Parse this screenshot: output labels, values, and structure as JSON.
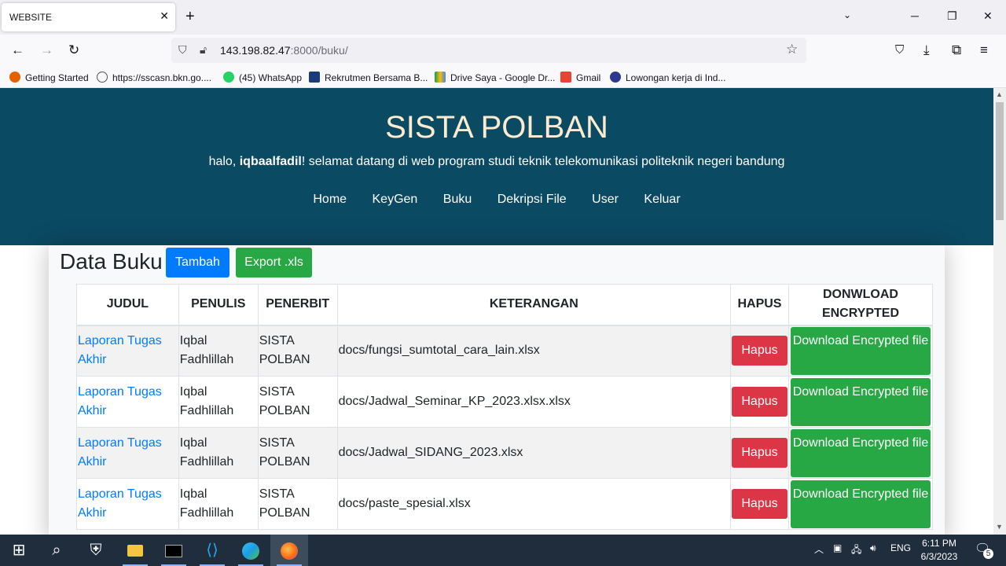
{
  "browser": {
    "tab_title": "WEBSITE",
    "url_host": "143.198.82.47",
    "url_path": ":8000/buku/",
    "bookmarks": [
      {
        "label": "Getting Started",
        "color": "#e66000"
      },
      {
        "label": "https://sscasn.bkn.go....",
        "color": "#555555"
      },
      {
        "label": "(45) WhatsApp",
        "color": "#25d366"
      },
      {
        "label": "Rekrutmen Bersama B...",
        "color": "#1a3b7a"
      },
      {
        "label": "Drive Saya - Google Dr...",
        "color": "#fbbc04"
      },
      {
        "label": "Gmail",
        "color": "#ea4335"
      },
      {
        "label": "Lowongan kerja di Ind...",
        "color": "#2b3990"
      }
    ]
  },
  "header": {
    "site_title": "SISTA POLBAN",
    "greeting_prefix": "halo, ",
    "username": "iqbaalfadil",
    "greeting_suffix": "! selamat datang di web program studi teknik telekomunikasi politeknik negeri bandung",
    "menu": [
      "Home",
      "KeyGen",
      "Buku",
      "Dekripsi File",
      "User",
      "Keluar"
    ]
  },
  "main": {
    "heading": "Data Buku",
    "add_button": "Tambah",
    "export_button": "Export .xls",
    "columns": [
      "JUDUL",
      "PENULIS",
      "PENERBIT",
      "KETERANGAN",
      "HAPUS",
      "DONWLOAD ENCRYPTED"
    ],
    "rows": [
      {
        "judul": "Laporan Tugas Akhir",
        "penulis": "Iqbal Fadhlillah",
        "penerbit": "SISTA POLBAN",
        "keterangan": "docs/fungsi_sumtotal_cara_lain.xlsx",
        "hapus": "Hapus",
        "download": "Download Encrypted file"
      },
      {
        "judul": "Laporan Tugas Akhir",
        "penulis": "Iqbal Fadhlillah",
        "penerbit": "SISTA POLBAN",
        "keterangan": "docs/Jadwal_Seminar_KP_2023.xlsx.xlsx",
        "hapus": "Hapus",
        "download": "Download Encrypted file"
      },
      {
        "judul": "Laporan Tugas Akhir",
        "penulis": "Iqbal Fadhlillah",
        "penerbit": "SISTA POLBAN",
        "keterangan": "docs/Jadwal_SIDANG_2023.xlsx",
        "hapus": "Hapus",
        "download": "Download Encrypted file"
      },
      {
        "judul": "Laporan Tugas Akhir",
        "penulis": "Iqbal Fadhlillah",
        "penerbit": "SISTA POLBAN",
        "keterangan": "docs/paste_spesial.xlsx",
        "hapus": "Hapus",
        "download": "Download Encrypted file"
      }
    ]
  },
  "taskbar": {
    "lang": "ENG",
    "time": "6:11 PM",
    "date": "6/3/2023",
    "notifications": "5"
  },
  "colors": {
    "header_bg": "#0b4a63",
    "title": "#fdebd0",
    "primary": "#007bff",
    "success": "#28a745",
    "danger": "#dc3545"
  }
}
